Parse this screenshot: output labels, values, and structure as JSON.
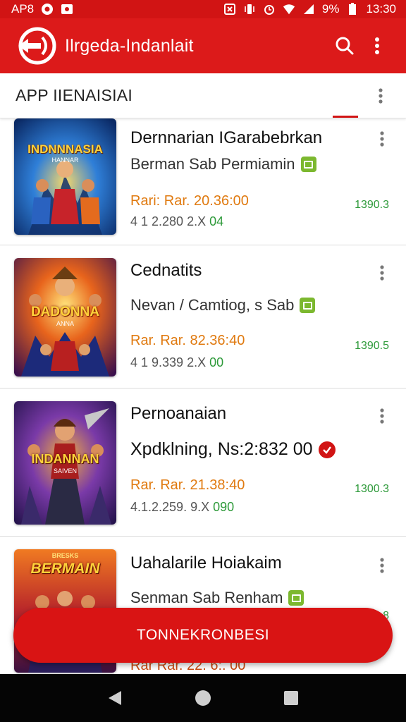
{
  "status_bar": {
    "carrier": "AP8",
    "battery": "9%",
    "time": "13:30"
  },
  "app_bar": {
    "title": "Ilrgeda-Indanlait"
  },
  "section": {
    "title": "APP IIENAISIAI"
  },
  "items": [
    {
      "title": "Dernnarian IGarabebrkan",
      "subtitle": "Berman Sab Permiamin",
      "price": "Rari: Rar. 20.36:00",
      "meta": "4 1 2.280 2.X",
      "meta_accent": "04",
      "count": "1390.3",
      "thumb_text": "INDNNNASIA",
      "thumb_subtext": "HANNAR"
    },
    {
      "title": "Cednatits",
      "subtitle": "Nevan / Camtiog, s Sab",
      "price": "Rar. Rar. 82.36:40",
      "meta": "4 1 9.339 2.X",
      "meta_accent": "00",
      "count": "1390.5",
      "thumb_text": "DADONNA",
      "thumb_subtext": "ANNA"
    },
    {
      "title": "Pernoanaian",
      "subtitle": "Xpdklning, Ns:2:832 00",
      "price": "Rar. Rar. 21.38:40",
      "meta": "4.1.2.259. 9.X",
      "meta_accent": "090",
      "count": "1300.3",
      "thumb_text": "INDANNAN",
      "thumb_subtext": "SAIVEN"
    },
    {
      "title": "Uahalarile Hoiakaim",
      "subtitle": "Senman Sab Renham",
      "price": "Rar Rar. 22. 6:. 00",
      "meta": "",
      "meta_accent": "",
      "count": "1390.8",
      "thumb_text": "BERMAIN",
      "thumb_subtext": "BRESKS"
    }
  ],
  "fab": {
    "label": "TONNEKRONBESI"
  },
  "colors": {
    "primary": "#dc1a1a",
    "price": "#e07a10",
    "count": "#2e9a3a",
    "badge": "#7cb82f"
  },
  "icons": {
    "search": "search-icon",
    "more": "more-vert-icon",
    "back": "nav-back-icon",
    "home": "nav-home-icon",
    "recents": "nav-recents-icon"
  }
}
